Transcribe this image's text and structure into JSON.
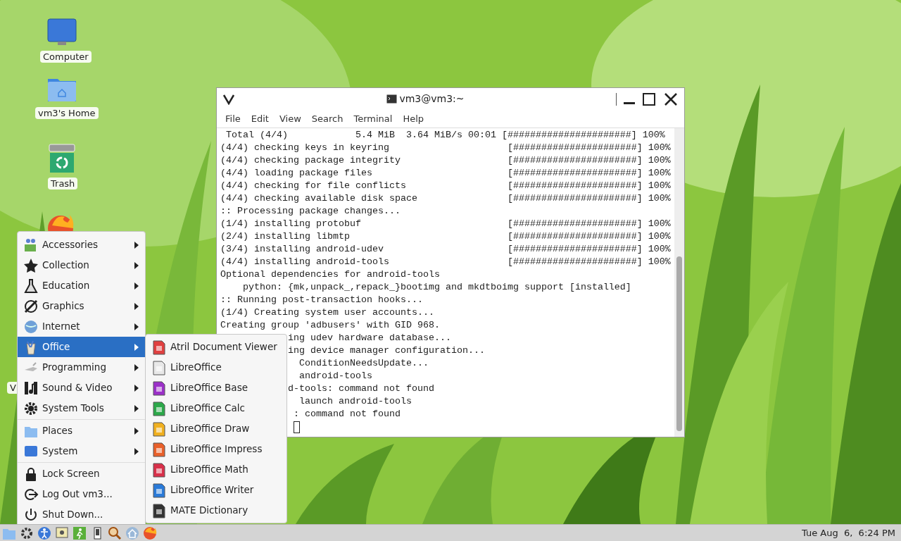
{
  "desktop_icons": [
    {
      "label": "Computer"
    },
    {
      "label": "vm3's Home"
    },
    {
      "label": "Trash"
    },
    {
      "label": "V"
    }
  ],
  "terminal": {
    "title": "vm3@vm3:~",
    "menu": [
      "File",
      "Edit",
      "View",
      "Search",
      "Terminal",
      "Help"
    ],
    "lines": [
      " Total (4/4)            5.4 MiB  3.64 MiB/s 00:01 [######################] 100%",
      "(4/4) checking keys in keyring                     [######################] 100%",
      "(4/4) checking package integrity                   [######################] 100%",
      "(4/4) loading package files                        [######################] 100%",
      "(4/4) checking for file conflicts                  [######################] 100%",
      "(4/4) checking available disk space                [######################] 100%",
      ":: Processing package changes...",
      "(1/4) installing protobuf                          [######################] 100%",
      "(2/4) installing libmtp                            [######################] 100%",
      "(3/4) installing android-udev                      [######################] 100%",
      "(4/4) installing android-tools                     [######################] 100%",
      "Optional dependencies for android-tools",
      "    python: {mk,unpack_,repack_}bootimg and mkdtboimg support [installed]",
      ":: Running post-transaction hooks...",
      "(1/4) Creating system user accounts...",
      "Creating group 'adbusers' with GID 968."
    ],
    "covered_lines": [
      "ing udev hardware database...",
      "ing device manager configuration...",
      "  ConditionNeedsUpdate...",
      "  android-tools",
      "d-tools: command not found",
      "  launch android-tools",
      " : command not found"
    ]
  },
  "app_menu": {
    "groups": [
      [
        {
          "label": "Accessories",
          "selected": false
        },
        {
          "label": "Collection",
          "selected": false
        },
        {
          "label": "Education",
          "selected": false
        },
        {
          "label": "Graphics",
          "selected": false
        },
        {
          "label": "Internet",
          "selected": false
        },
        {
          "label": "Office",
          "selected": true
        },
        {
          "label": "Programming",
          "selected": false
        },
        {
          "label": "Sound & Video",
          "selected": false
        },
        {
          "label": "System Tools",
          "selected": false
        }
      ],
      [
        {
          "label": "Places",
          "selected": false
        },
        {
          "label": "System",
          "selected": false
        }
      ],
      [
        {
          "label": "Lock Screen",
          "selected": false,
          "kind": "action"
        },
        {
          "label": "Log Out vm3...",
          "selected": false,
          "kind": "action"
        },
        {
          "label": "Shut Down...",
          "selected": false,
          "kind": "action"
        }
      ]
    ]
  },
  "submenu": [
    {
      "label": "Atril Document Viewer",
      "color": "#e04040"
    },
    {
      "label": "LibreOffice",
      "color": "#e8e8e8"
    },
    {
      "label": "LibreOffice Base",
      "color": "#9b30c8"
    },
    {
      "label": "LibreOffice Calc",
      "color": "#2ca84a"
    },
    {
      "label": "LibreOffice Draw",
      "color": "#f0b020"
    },
    {
      "label": "LibreOffice Impress",
      "color": "#e8602a"
    },
    {
      "label": "LibreOffice Math",
      "color": "#d8304a"
    },
    {
      "label": "LibreOffice Writer",
      "color": "#2a7ad8"
    },
    {
      "label": "MATE Dictionary",
      "color": "#333333"
    }
  ],
  "taskbar": {
    "clock": "Tue Aug  6,  6:24 PM"
  }
}
